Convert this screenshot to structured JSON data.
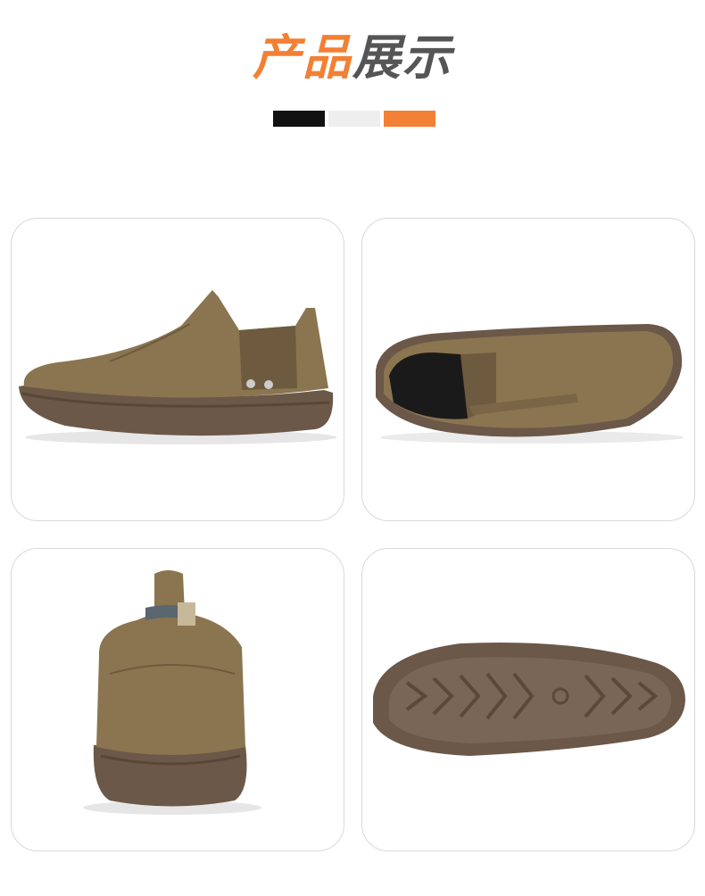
{
  "header": {
    "title_part1": "产品",
    "title_part2": "展示"
  },
  "color_bar": {
    "colors": [
      "#111111",
      "#eeeeee",
      "#f28035"
    ]
  },
  "gallery": {
    "items": [
      {
        "view": "side"
      },
      {
        "view": "top-angle"
      },
      {
        "view": "heel"
      },
      {
        "view": "sole"
      }
    ]
  },
  "colors": {
    "accent": "#f28035",
    "suede": "#8a7550",
    "sole": "#6b5848"
  }
}
